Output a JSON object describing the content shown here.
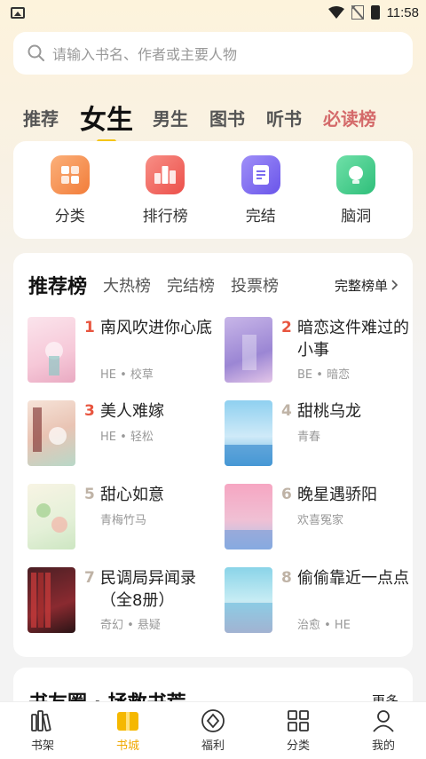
{
  "status": {
    "time": "11:58"
  },
  "search": {
    "placeholder": "请输入书名、作者或主要人物"
  },
  "tabs": [
    {
      "label": "推荐"
    },
    {
      "label": "女生"
    },
    {
      "label": "男生"
    },
    {
      "label": "图书"
    },
    {
      "label": "听书"
    },
    {
      "label": "必读榜"
    }
  ],
  "quick": [
    {
      "label": "分类",
      "icon": "grid-icon",
      "color": "#f59a5a"
    },
    {
      "label": "排行榜",
      "icon": "ranking-icon",
      "color": "#f2706a"
    },
    {
      "label": "完结",
      "icon": "book-done-icon",
      "color": "#7a6cf0"
    },
    {
      "label": "脑洞",
      "icon": "bulb-icon",
      "color": "#3fcf8a"
    }
  ],
  "rank": {
    "tabs": [
      {
        "label": "推荐榜"
      },
      {
        "label": "大热榜"
      },
      {
        "label": "完结榜"
      },
      {
        "label": "投票榜"
      }
    ],
    "more": "完整榜单",
    "books": [
      {
        "num": "1",
        "title": "南风吹进你心底",
        "tags": "HE • 校草",
        "num_color": "#e8553f"
      },
      {
        "num": "2",
        "title": "暗恋这件难过的小事",
        "tags": "BE • 暗恋",
        "num_color": "#e8553f"
      },
      {
        "num": "3",
        "title": "美人难嫁",
        "tags": "HE • 轻松",
        "num_color": "#e8553f"
      },
      {
        "num": "4",
        "title": "甜桃乌龙",
        "tags": "青春",
        "num_color": "#bfb3a6"
      },
      {
        "num": "5",
        "title": "甜心如意",
        "tags": "青梅竹马",
        "num_color": "#bfb3a6"
      },
      {
        "num": "6",
        "title": "晚星遇骄阳",
        "tags": "欢喜冤家",
        "num_color": "#bfb3a6"
      },
      {
        "num": "7",
        "title": "民调局异闻录（全8册）",
        "tags": "奇幻 • 悬疑",
        "num_color": "#bfb3a6"
      },
      {
        "num": "8",
        "title": "偷偷靠近一点点",
        "tags": "治愈 • HE",
        "num_color": "#bfb3a6"
      }
    ]
  },
  "teaser": {
    "title": "书友圈 · 拯救书荒",
    "more": "更多"
  },
  "bottomnav": [
    {
      "label": "书架",
      "icon": "bookshelf-icon"
    },
    {
      "label": "书城",
      "icon": "bookstore-icon"
    },
    {
      "label": "福利",
      "icon": "welfare-icon"
    },
    {
      "label": "分类",
      "icon": "category-icon"
    },
    {
      "label": "我的",
      "icon": "profile-icon"
    }
  ],
  "colors": {
    "accent": "#f5c518",
    "active_nav": "#f0a800",
    "rank_top": "#e8553f"
  }
}
